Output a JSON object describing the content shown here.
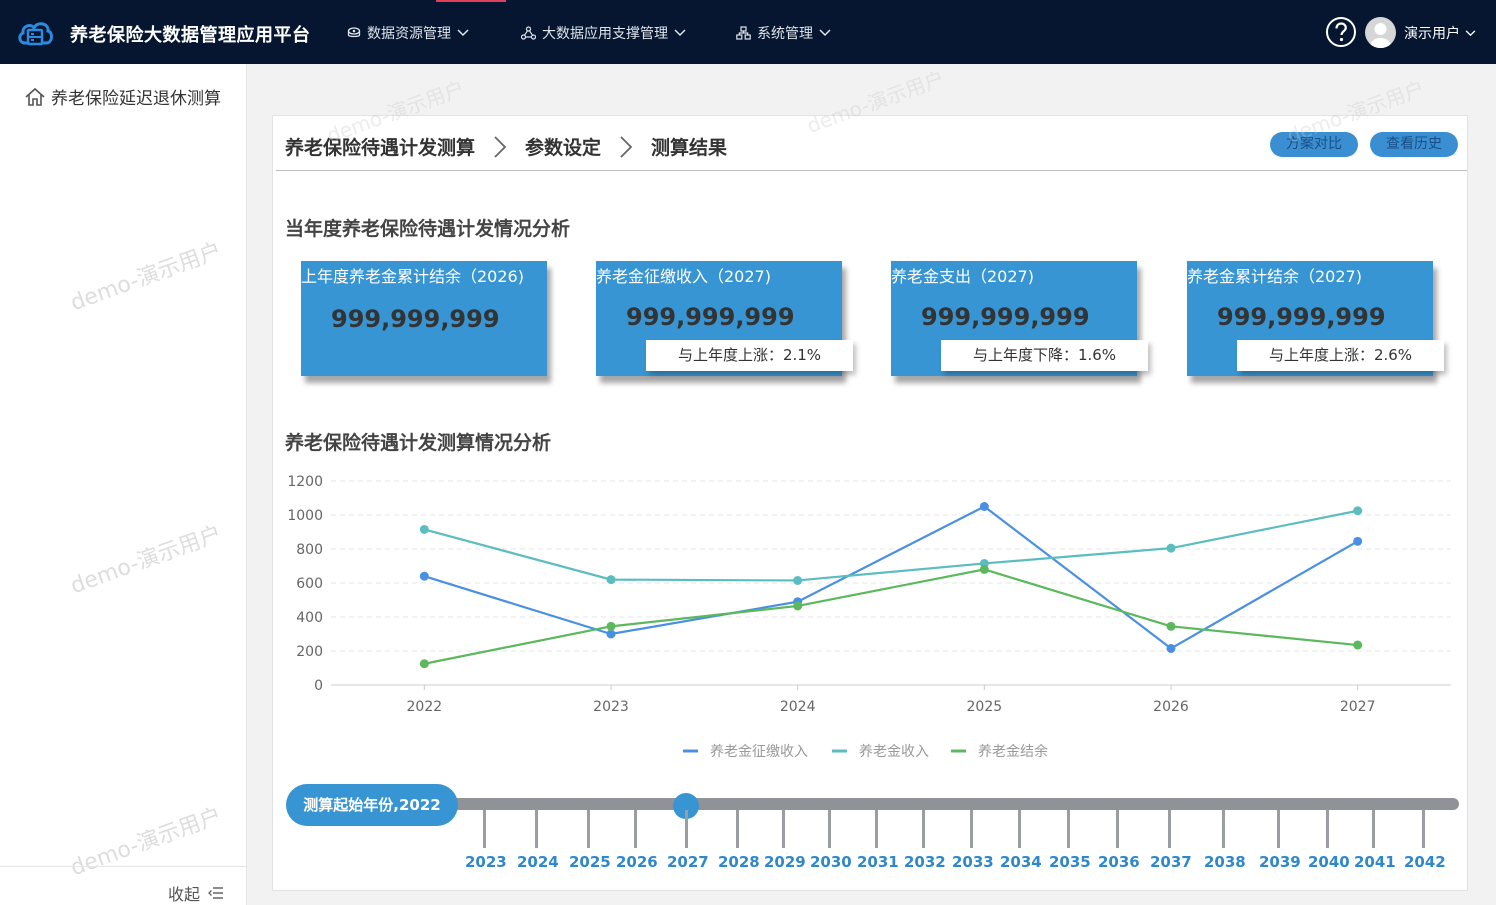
{
  "app": {
    "title": "养老保险大数据管理应用平台"
  },
  "nav": [
    {
      "label": "数据资源管理",
      "icon": "database-icon"
    },
    {
      "label": "大数据应用支撑管理",
      "icon": "network-icon"
    },
    {
      "label": "系统管理",
      "icon": "sitemap-icon"
    }
  ],
  "user": {
    "name": "演示用户"
  },
  "sidebar": {
    "item_label": "养老保险延迟退休测算",
    "collapse_label": "收起"
  },
  "watermark": "demo-演示用户",
  "breadcrumb": [
    "养老保险待遇计发测算",
    "参数设定",
    "测算结果"
  ],
  "actions": {
    "compare": "方案对比",
    "history": "查看历史"
  },
  "sections": {
    "current": "当年度养老保险待遇计发情况分析",
    "trend": "养老保险待遇计发测算情况分析"
  },
  "cards": [
    {
      "title": "上年度养老金累计结余（2026)",
      "value": "999,999,999",
      "change": ""
    },
    {
      "title": "养老金征缴收入（2027)",
      "value": "999,999,999",
      "change": "与上年度上涨：2.1%"
    },
    {
      "title": "养老金支出（2027)",
      "value": "999,999,999",
      "change": "与上年度下降：1.6%"
    },
    {
      "title": "养老金累计结余（2027)",
      "value": "999,999,999",
      "change": "与上年度上涨：2.6%"
    }
  ],
  "chart_data": {
    "type": "line",
    "x": [
      "2022",
      "2023",
      "2024",
      "2025",
      "2026",
      "2027"
    ],
    "yticks": [
      "0",
      "200",
      "400",
      "600",
      "800",
      "1000",
      "1200"
    ],
    "ylim": [
      0,
      1200
    ],
    "series": [
      {
        "name": "养老金征缴收入",
        "color": "#4a90e2",
        "values": [
          640,
          300,
          490,
          1050,
          215,
          845
        ]
      },
      {
        "name": "养老金收入",
        "color": "#5bbdbf",
        "values": [
          915,
          620,
          615,
          715,
          805,
          1025
        ]
      },
      {
        "name": "养老金结余",
        "color": "#5cb85c",
        "values": [
          125,
          345,
          465,
          680,
          345,
          235
        ]
      }
    ],
    "grid": true,
    "legend": "bottom"
  },
  "timeline": {
    "start_label": "测算起始年份,2022",
    "years": [
      "2023",
      "2024",
      "2025",
      "2026",
      "2027",
      "2028",
      "2029",
      "2030",
      "2031",
      "2032",
      "2033",
      "2034",
      "2035",
      "2036",
      "2037",
      "2038",
      "2039",
      "2040",
      "2041",
      "2042"
    ],
    "selected": "2027"
  },
  "colors": {
    "topbar": "#061630",
    "accent": "#3795d3"
  }
}
